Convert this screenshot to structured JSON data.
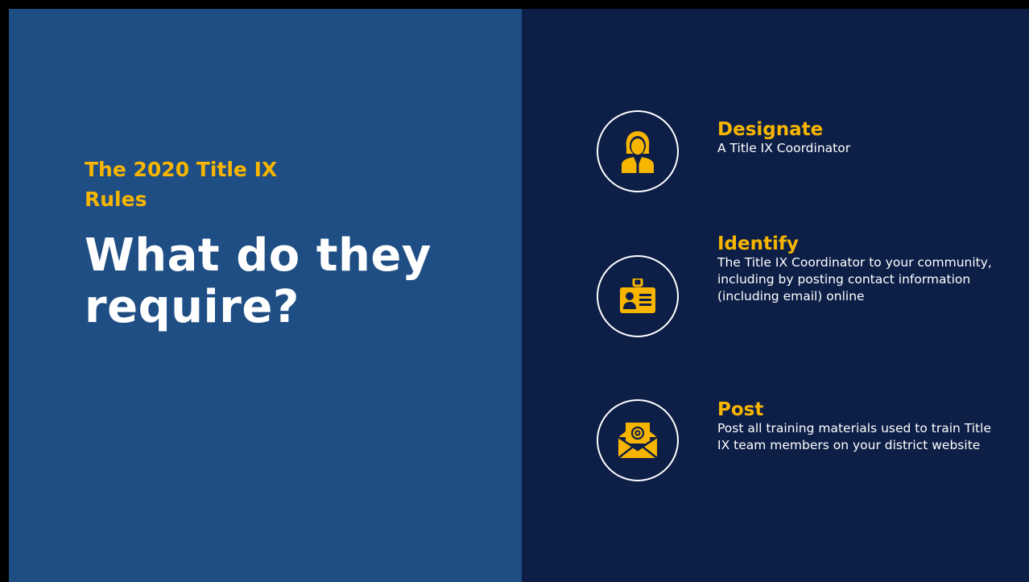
{
  "slide": {
    "subtitle": "The 2020 Title IX Rules",
    "title": "What do they require?",
    "colors": {
      "left_background": "#1f4e85",
      "right_background": "#0d1f47",
      "accent": "#f7b500",
      "text": "#ffffff"
    }
  },
  "items": [
    {
      "icon": "person-icon",
      "title": "Designate",
      "description": "A Title IX Coordinator"
    },
    {
      "icon": "id-badge-icon",
      "title": "Identify",
      "description": "The Title IX Coordinator to your community, including by posting contact information (including email) online"
    },
    {
      "icon": "email-envelope-icon",
      "title": "Post",
      "description": "Post all training materials used to train Title IX team members on your district website"
    }
  ]
}
